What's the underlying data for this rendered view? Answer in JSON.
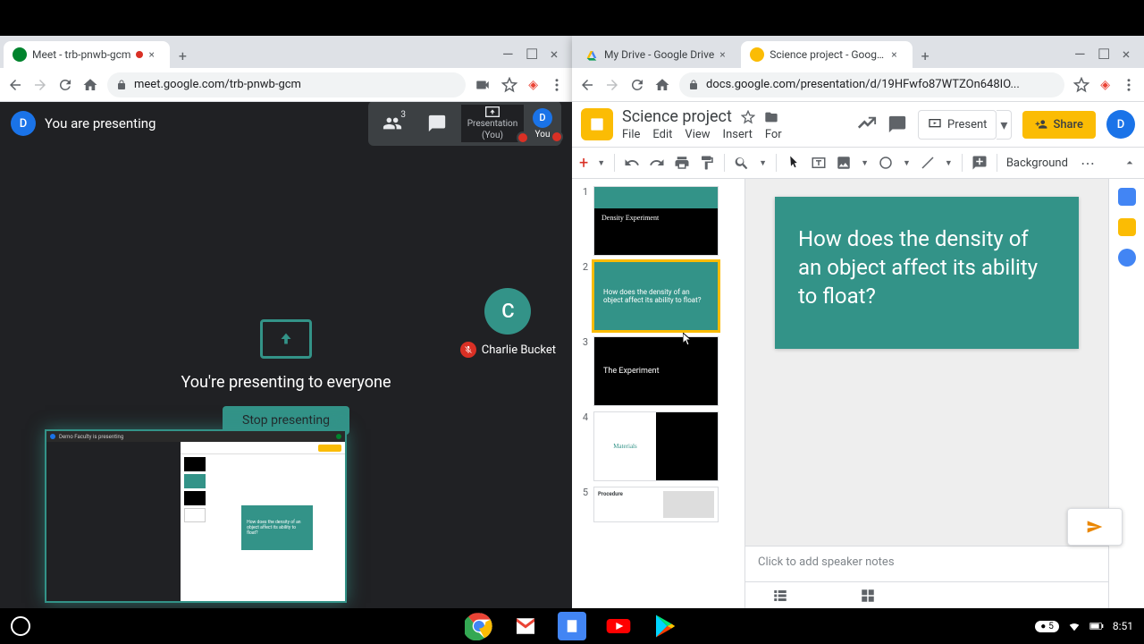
{
  "meet_window": {
    "tab": {
      "title": "Meet - trb-pnwb-gcm"
    },
    "url": "meet.google.com/trb-pnwb-gcm",
    "presenting_banner": "You are presenting",
    "participants_count": "3",
    "presentation_tile": {
      "line1": "Presentation",
      "line2": "(You)"
    },
    "you_label": "You",
    "main_message": "You're presenting to everyone",
    "stop_button": "Stop presenting",
    "participant": {
      "initial": "C",
      "name": "Charlie Bucket"
    },
    "avatar_initial": "D"
  },
  "slides_window": {
    "tabs": [
      {
        "title": "My Drive - Google Drive"
      },
      {
        "title": "Science project - Google Slides"
      }
    ],
    "url": "docs.google.com/presentation/d/19HFwfo87WTZOn648IO...",
    "doc_title": "Science project",
    "menus": [
      "File",
      "Edit",
      "View",
      "Insert",
      "For"
    ],
    "present_label": "Present",
    "share_label": "Share",
    "background_label": "Background",
    "slides": [
      {
        "num": "1",
        "title": "Density Experiment"
      },
      {
        "num": "2",
        "text": "How does the density of an object affect its ability to float?"
      },
      {
        "num": "3",
        "title": "The Experiment"
      },
      {
        "num": "4",
        "title": "Materials"
      },
      {
        "num": "5",
        "title": "Procedure"
      }
    ],
    "main_slide_text": "How does the density of an object affect its ability to float?",
    "speaker_notes_placeholder": "Click to add speaker notes",
    "avatar_initial": "D"
  },
  "taskbar": {
    "count_badge": "5",
    "clock": "8:51"
  },
  "colors": {
    "teal": "#339388",
    "yellow": "#fbbc04",
    "blue": "#1a73e8"
  }
}
